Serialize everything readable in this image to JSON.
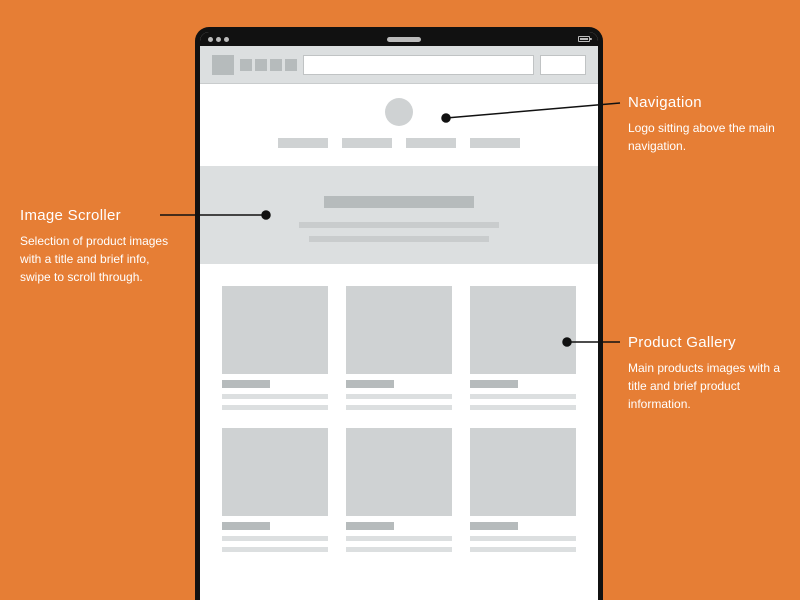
{
  "annotations": {
    "navigation": {
      "title": "Navigation",
      "body": "Logo sitting above the main navigation."
    },
    "scroller": {
      "title": "Image Scroller",
      "body": "Selection of product images with a title and brief info, swipe to scroll through."
    },
    "gallery": {
      "title": "Product Gallery",
      "body": "Main products images with a title and brief product information."
    }
  }
}
